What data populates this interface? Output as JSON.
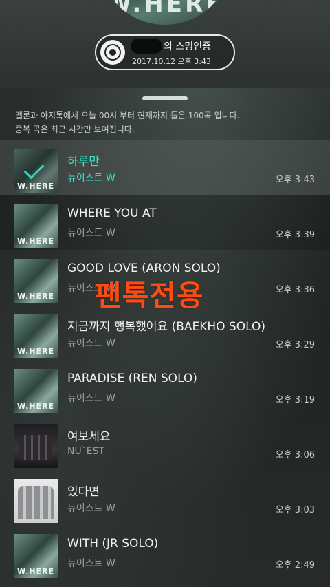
{
  "header": {
    "album_text": "W.HERE",
    "badge_title": "의 스밍인증",
    "badge_datetime": "2017.10.12 오후 3:43"
  },
  "notice": {
    "line1": "멜론과 아지톡에서 오늘 00시 부터 현재까지 들은 100곡 입니다.",
    "line2": "중복 곡은 최근 시간만 보여집니다."
  },
  "accent_color": "#3ee0cb",
  "watermark": "팬톡전용",
  "songs": [
    {
      "title": "하루만",
      "artist": "뉴이스트 W",
      "time": "오후 3:43"
    },
    {
      "title": "WHERE YOU AT",
      "artist": "뉴이스트 W",
      "time": "오후 3:39"
    },
    {
      "title": "GOOD LOVE (ARON SOLO)",
      "artist": "뉴이스트 W",
      "time": "오후 3:36"
    },
    {
      "title": "지금까지 행복했어요 (BAEKHO SOLO)",
      "artist": "뉴이스트 W",
      "time": "오후 3:29"
    },
    {
      "title": "PARADISE (REN SOLO)",
      "artist": "뉴이스트 W",
      "time": "오후 3:19"
    },
    {
      "title": "여보세요",
      "artist": "NU`EST",
      "time": "오후 3:06"
    },
    {
      "title": "있다면",
      "artist": "뉴이스트 W",
      "time": "오후 3:03"
    },
    {
      "title": "WITH (JR SOLO)",
      "artist": "뉴이스트 W",
      "time": "오후 2:49"
    }
  ]
}
